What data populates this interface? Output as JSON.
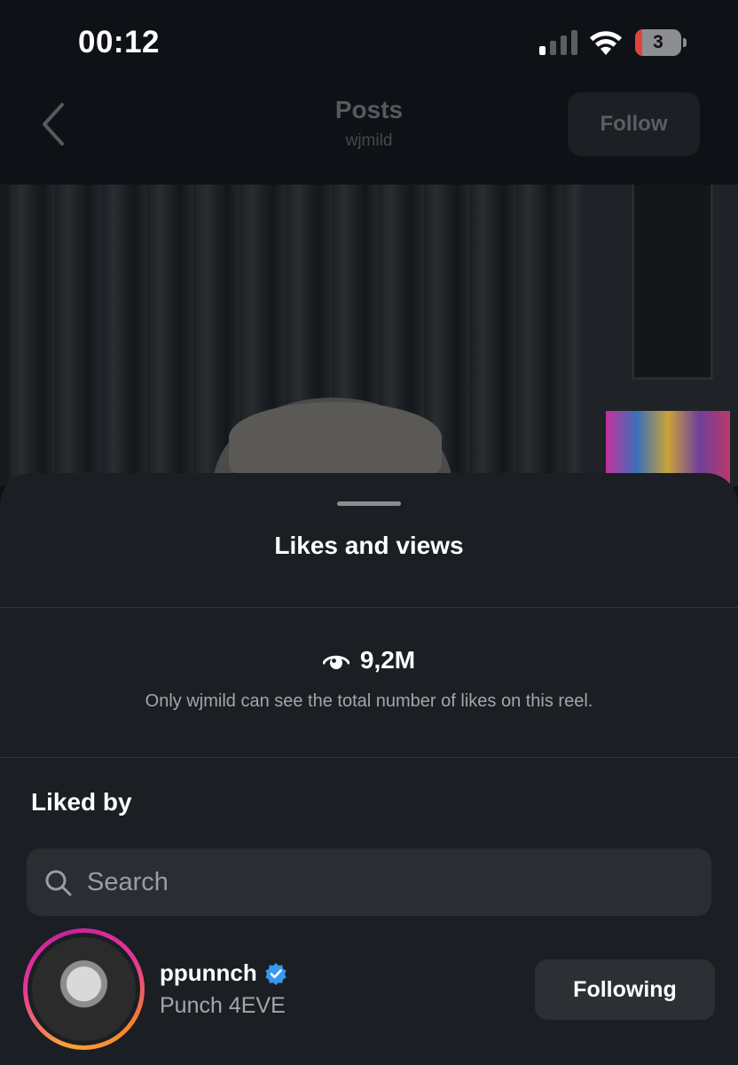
{
  "status_bar": {
    "time": "00:12",
    "battery_level": "3",
    "battery_color": "#e0443e"
  },
  "header": {
    "back_icon": "chevron-left-icon",
    "title": "Posts",
    "subtitle": "wjmild",
    "follow_label": "Follow"
  },
  "sheet": {
    "title": "Likes and views",
    "views_icon": "eye-icon",
    "views_count": "9,2M",
    "views_note": "Only wjmild can see the total number of likes on this reel.",
    "liked_by_label": "Liked by",
    "search": {
      "placeholder": "Search",
      "value": ""
    },
    "users": [
      {
        "username": "ppunnch",
        "verified": true,
        "full_name": "Punch 4EVE",
        "button_label": "Following"
      }
    ]
  },
  "colors": {
    "background": "#0e1115",
    "sheet": "#1b1e22",
    "verified_badge": "#3897f0"
  }
}
